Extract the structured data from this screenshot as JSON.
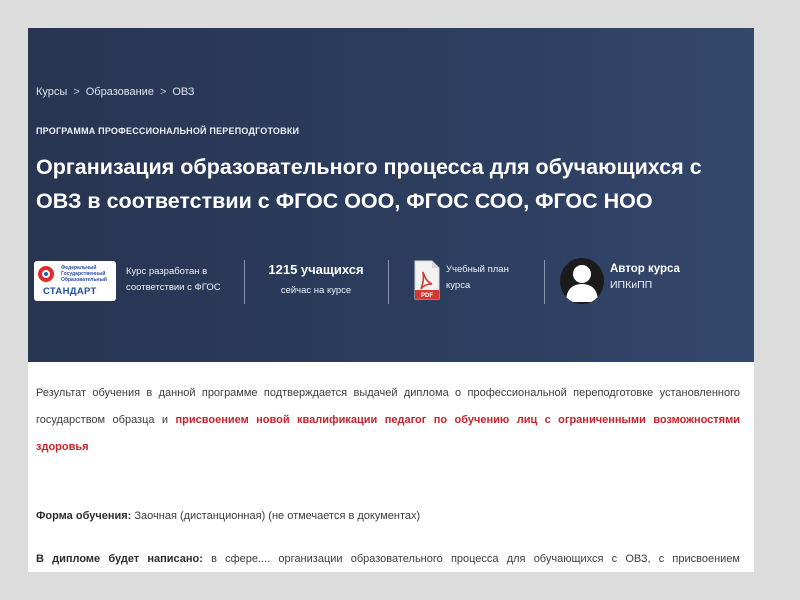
{
  "breadcrumb": {
    "items": [
      "Курсы",
      "Образование",
      "ОВЗ"
    ],
    "separator": ">"
  },
  "hero": {
    "eyebrow": "ПРОГРАММА ПРОФЕССИОНАЛЬНОЙ ПЕРЕПОДГОТОВКИ",
    "title": "Организация образовательного процесса для обучающихся с ОВЗ в соответствии с ФГОС ООО, ФГОС СОО, ФГОС НОО"
  },
  "meta": {
    "fgos": {
      "logo_text_small": "Федеральный Государственный Образовательный",
      "logo_text_big": "СТАНДАРТ",
      "line1": "Курс разработан в",
      "line2": "соответствии с ФГОС"
    },
    "students": {
      "count": "1215 учащихся",
      "caption": "сейчас на курсе"
    },
    "plan": {
      "pdf_label": "PDF",
      "line1": "Учебный план",
      "line2": "курса"
    },
    "author": {
      "label": "Автор курса",
      "name": "ИПКиПП"
    }
  },
  "content": {
    "result_text": "Результат обучения в данной программе подтверждается выдачей диплома о профессиональной переподготовке установленного государством образца и ",
    "result_highlight": "присвоением новой квалификации педагог по обучению лиц с ограниченными возможностями здоровья",
    "form_label": "Форма обучения:",
    "form_value": " Заочная (дистанционная) (не отмечается в документах)",
    "diploma_label": "В дипломе будет написано:",
    "diploma_value": " в сфере.... организации образовательного процесса для обучающихся с ОВЗ, с присвоением квалификации учитель (преподаватель) лиц с ограниченными возможностями здоровья."
  },
  "colors": {
    "hero_bg": "#2c3d5e",
    "highlight_red": "#c8232c"
  }
}
